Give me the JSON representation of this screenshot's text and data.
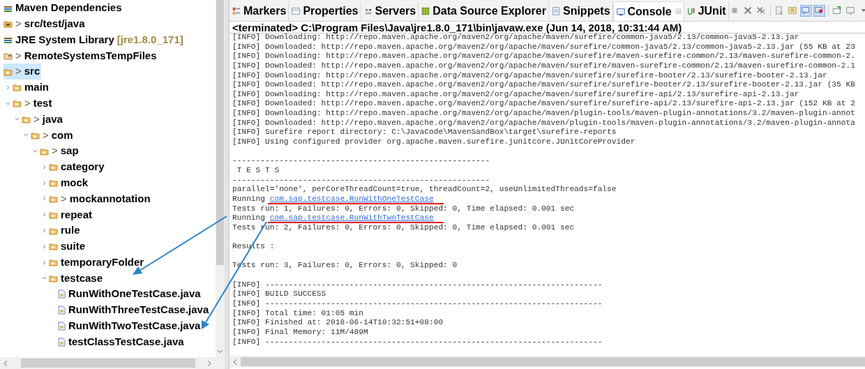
{
  "project_tree": [
    {
      "label": "Maven Dependencies",
      "kind": "library",
      "selected": false
    },
    {
      "label": "src/test/java",
      "prefix": ">",
      "kind": "source",
      "selected": false
    },
    {
      "label": "JRE System Library",
      "decoration": "[jre1.8.0_171]",
      "kind": "library",
      "selected": false
    },
    {
      "label": "RemoteSystemsTempFiles",
      "prefix": ">",
      "kind": "project",
      "selected": false
    },
    {
      "label": "src",
      "prefix": ">",
      "kind": "folder",
      "selected": true,
      "children": [
        {
          "label": "main",
          "kind": "folder",
          "expanded": false,
          "selected": false
        },
        {
          "label": "test",
          "prefix": ">",
          "kind": "folder",
          "expanded": true,
          "selected": false,
          "children": [
            {
              "label": "java",
              "prefix": ">",
              "kind": "folder",
              "expanded": true,
              "selected": false,
              "children": [
                {
                  "label": "com",
                  "prefix": ">",
                  "kind": "folder",
                  "expanded": true,
                  "selected": false,
                  "children": [
                    {
                      "label": "sap",
                      "prefix": ">",
                      "kind": "folder",
                      "expanded": true,
                      "selected": false,
                      "children": [
                        {
                          "label": "category",
                          "kind": "folder",
                          "expanded": false,
                          "selected": false
                        },
                        {
                          "label": "mock",
                          "kind": "folder",
                          "expanded": false,
                          "selected": false
                        },
                        {
                          "label": "mockannotation",
                          "prefix": ">",
                          "kind": "folder",
                          "expanded": false,
                          "selected": false
                        },
                        {
                          "label": "repeat",
                          "kind": "folder",
                          "expanded": false,
                          "selected": false
                        },
                        {
                          "label": "rule",
                          "kind": "folder",
                          "expanded": false,
                          "selected": false
                        },
                        {
                          "label": "suite",
                          "kind": "folder",
                          "expanded": false,
                          "selected": false
                        },
                        {
                          "label": "temporaryFolder",
                          "kind": "folder",
                          "expanded": false,
                          "selected": false
                        },
                        {
                          "label": "testcase",
                          "kind": "folder",
                          "expanded": true,
                          "selected": false,
                          "children": [
                            {
                              "label": "RunWithOneTestCase.java",
                              "kind": "file",
                              "selected": false
                            },
                            {
                              "label": "RunWithThreeTestCase.java",
                              "kind": "file",
                              "selected": false
                            },
                            {
                              "label": "RunWithTwoTestCase.java",
                              "kind": "file",
                              "selected": false
                            },
                            {
                              "label": "testClassTestCase.java",
                              "kind": "file",
                              "selected": false
                            }
                          ]
                        }
                      ]
                    }
                  ]
                }
              ]
            }
          ]
        }
      ]
    }
  ],
  "tabs": [
    {
      "label": "Markers",
      "selected": false
    },
    {
      "label": "Properties",
      "selected": false
    },
    {
      "label": "Servers",
      "selected": false
    },
    {
      "label": "Data Source Explorer",
      "selected": false
    },
    {
      "label": "Snippets",
      "selected": false
    },
    {
      "label": "Console",
      "selected": true,
      "close": "☒"
    },
    {
      "label": "JUnit",
      "selected": false
    }
  ],
  "toolbar": [
    {
      "pressed": false
    },
    {
      "pressed": false
    },
    {
      "pressed": false
    },
    {
      "pressed": false
    },
    {
      "pressed": false
    },
    {
      "pressed": true
    },
    {
      "pressed": true
    },
    {
      "pressed": false
    },
    {
      "pressed": false
    },
    {
      "pressed": false
    }
  ],
  "console": {
    "header": "<terminated> C:\\Program Files\\Java\\jre1.8.0_171\\bin\\javaw.exe (Jun 14, 2018, 10:31:44 AM)",
    "lines": [
      {
        "kind": "text",
        "text": "[INFO] Downloading: http://repo.maven.apache.org/maven2/org/apache/maven/surefire/common-java5/2.13/common-java5-2.13.jar"
      },
      {
        "kind": "text",
        "text": "[INFO] Downloaded: http://repo.maven.apache.org/maven2/org/apache/maven/surefire/common-java5/2.13/common-java5-2.13.jar (55 KB at 23"
      },
      {
        "kind": "text",
        "text": "[INFO] Downloading: http://repo.maven.apache.org/maven2/org/apache/maven/surefire/maven-surefire-common/2.13/maven-surefire-common-2."
      },
      {
        "kind": "text",
        "text": "[INFO] Downloaded: http://repo.maven.apache.org/maven2/org/apache/maven/surefire/maven-surefire-common/2.13/maven-surefire-common-2.1"
      },
      {
        "kind": "text",
        "text": "[INFO] Downloading: http://repo.maven.apache.org/maven2/org/apache/maven/surefire/surefire-booter/2.13/surefire-booter-2.13.jar"
      },
      {
        "kind": "text",
        "text": "[INFO] Downloaded: http://repo.maven.apache.org/maven2/org/apache/maven/surefire/surefire-booter/2.13/surefire-booter-2.13.jar (35 KB"
      },
      {
        "kind": "text",
        "text": "[INFO] Downloading: http://repo.maven.apache.org/maven2/org/apache/maven/surefire/surefire-api/2.13/surefire-api-2.13.jar"
      },
      {
        "kind": "text",
        "text": "[INFO] Downloaded: http://repo.maven.apache.org/maven2/org/apache/maven/surefire/surefire-api/2.13/surefire-api-2.13.jar (152 KB at 2"
      },
      {
        "kind": "text",
        "text": "[INFO] Downloading: http://repo.maven.apache.org/maven2/org/apache/maven/plugin-tools/maven-plugin-annotations/3.2/maven-plugin-annot"
      },
      {
        "kind": "text",
        "text": "[INFO] Downloaded: http://repo.maven.apache.org/maven2/org/apache/maven/plugin-tools/maven-plugin-annotations/3.2/maven-plugin-annota"
      },
      {
        "kind": "text",
        "text": "[INFO] Surefire report directory: C:\\JavaCode\\MavenSandBox\\target\\surefire-reports"
      },
      {
        "kind": "text",
        "text": "[INFO] Using configured provider org.apache.maven.surefire.junitcore.JUnitCoreProvider"
      },
      {
        "kind": "blank"
      },
      {
        "kind": "text",
        "text": "-------------------------------------------------------"
      },
      {
        "kind": "text",
        "text": " T E S T S"
      },
      {
        "kind": "text",
        "text": "-------------------------------------------------------"
      },
      {
        "kind": "text",
        "text": "parallel='none', perCoreThreadCount=true, threadCount=2, useUnlimitedThreads=false"
      },
      {
        "kind": "run",
        "text": "Running",
        "link": "com.sap.testcase.RunWithOneTestCase",
        "marked": true
      },
      {
        "kind": "text",
        "text": "Tests run: 1, Failures: 0, Errors: 0, Skipped: 0, Time elapsed: 0.001 sec"
      },
      {
        "kind": "run",
        "text": "Running",
        "link": "com.sap.testcase.RunWithTwoTestCase",
        "marked": true
      },
      {
        "kind": "text",
        "text": "Tests run: 2, Failures: 0, Errors: 0, Skipped: 0, Time elapsed: 0.001 sec"
      },
      {
        "kind": "blank"
      },
      {
        "kind": "text",
        "text": "Results :"
      },
      {
        "kind": "blank"
      },
      {
        "kind": "text",
        "text": "Tests run: 3, Failures: 0, Errors: 0, Skipped: 0"
      },
      {
        "kind": "blank"
      },
      {
        "kind": "text",
        "text": "[INFO] ------------------------------------------------------------------------"
      },
      {
        "kind": "text",
        "text": "[INFO] BUILD SUCCESS"
      },
      {
        "kind": "text",
        "text": "[INFO] ------------------------------------------------------------------------"
      },
      {
        "kind": "text",
        "text": "[INFO] Total time: 01:05 min"
      },
      {
        "kind": "text",
        "text": "[INFO] Finished at: 2018-06-14T10:32:51+08:00"
      },
      {
        "kind": "text",
        "text": "[INFO] Final Memory: 11M/489M"
      },
      {
        "kind": "text",
        "text": "[INFO] ------------------------------------------------------------------------"
      }
    ]
  }
}
